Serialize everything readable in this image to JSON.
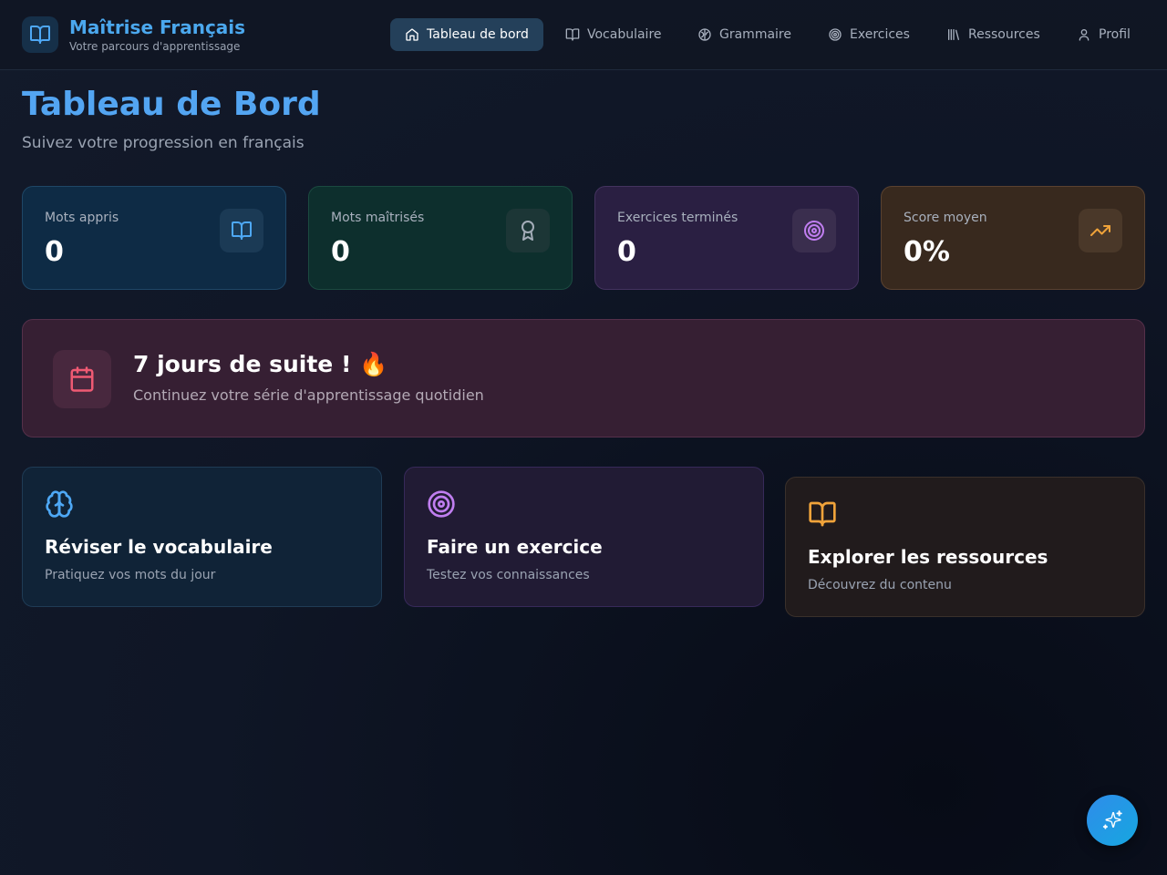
{
  "brand": {
    "title": "Maîtrise Français",
    "subtitle": "Votre parcours d'apprentissage",
    "logo_icon": "open-book-icon"
  },
  "nav": {
    "items": [
      {
        "label": "Tableau de bord",
        "icon": "home-icon",
        "active": true
      },
      {
        "label": "Vocabulaire",
        "icon": "book-icon",
        "active": false
      },
      {
        "label": "Grammaire",
        "icon": "brain-icon",
        "active": false
      },
      {
        "label": "Exercices",
        "icon": "target-icon",
        "active": false
      },
      {
        "label": "Ressources",
        "icon": "library-icon",
        "active": false
      },
      {
        "label": "Profil",
        "icon": "user-icon",
        "active": false
      }
    ]
  },
  "page": {
    "title": "Tableau de Bord",
    "subtitle": "Suivez votre progression en français"
  },
  "stats": [
    {
      "label": "Mots appris",
      "value": "0",
      "icon": "book-icon",
      "color": "#4ea8f5"
    },
    {
      "label": "Mots maîtrisés",
      "value": "0",
      "icon": "award-icon",
      "color": "#a4adb9"
    },
    {
      "label": "Exercices terminés",
      "value": "0",
      "icon": "target-icon",
      "color": "#c07ef0"
    },
    {
      "label": "Score moyen",
      "value": "0%",
      "icon": "trending-up-icon",
      "color": "#f0a33a"
    }
  ],
  "streak": {
    "title": "7 jours de suite ! 🔥",
    "subtitle": "Continuez votre série d'apprentissage quotidien",
    "icon": "calendar-icon",
    "color": "#ef5a73"
  },
  "actions": [
    {
      "title": "Réviser le vocabulaire",
      "subtitle": "Pratiquez vos mots du jour",
      "icon": "brain-icon",
      "color": "#4ea8f5"
    },
    {
      "title": "Faire un exercice",
      "subtitle": "Testez vos connaissances",
      "icon": "target-icon",
      "color": "#c07ef0"
    },
    {
      "title": "Explorer les ressources",
      "subtitle": "Découvrez du contenu",
      "icon": "book-icon",
      "color": "#f0a33a"
    }
  ],
  "fab": {
    "icon": "sparkles-icon"
  }
}
